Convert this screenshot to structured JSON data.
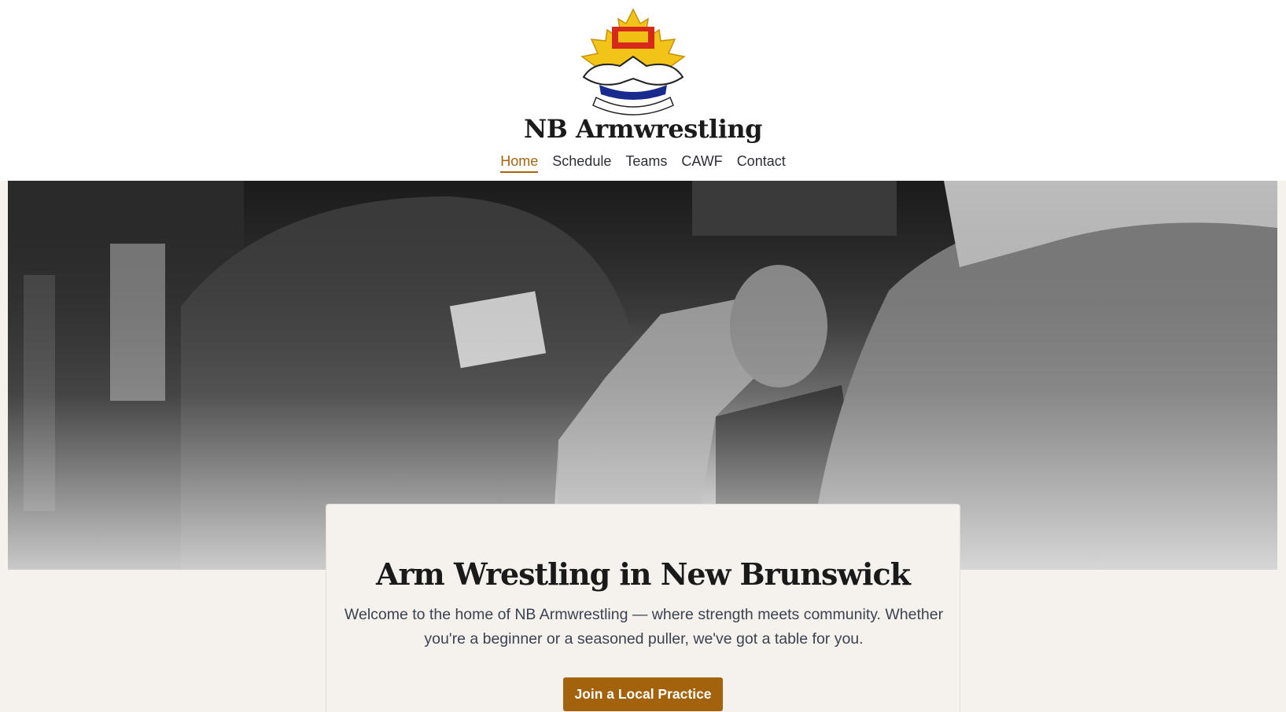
{
  "site": {
    "title": "NB Armwrestling",
    "logo": "New Brunswick Armwrestling Association crest (maple leaf, lion band, clasped arms)"
  },
  "nav": {
    "items": [
      {
        "label": "Home",
        "active": true
      },
      {
        "label": "Schedule",
        "active": false
      },
      {
        "label": "Teams",
        "active": false
      },
      {
        "label": "CAWF",
        "active": false
      },
      {
        "label": "Contact",
        "active": false
      }
    ]
  },
  "hero": {
    "image": "black-and-white photo of two men arm wrestling with a referee behind them"
  },
  "intro": {
    "heading": "Arm Wrestling in New Brunswick",
    "body": "Welcome to the home of NB Armwrestling — where strength meets community. Whether you're a beginner or a seasoned puller, we've got a table for you.",
    "cta_label": "Join a Local Practice"
  },
  "colors": {
    "accent": "#a3620c",
    "background": "#f5f2ee",
    "header_bg": "#ffffff"
  }
}
